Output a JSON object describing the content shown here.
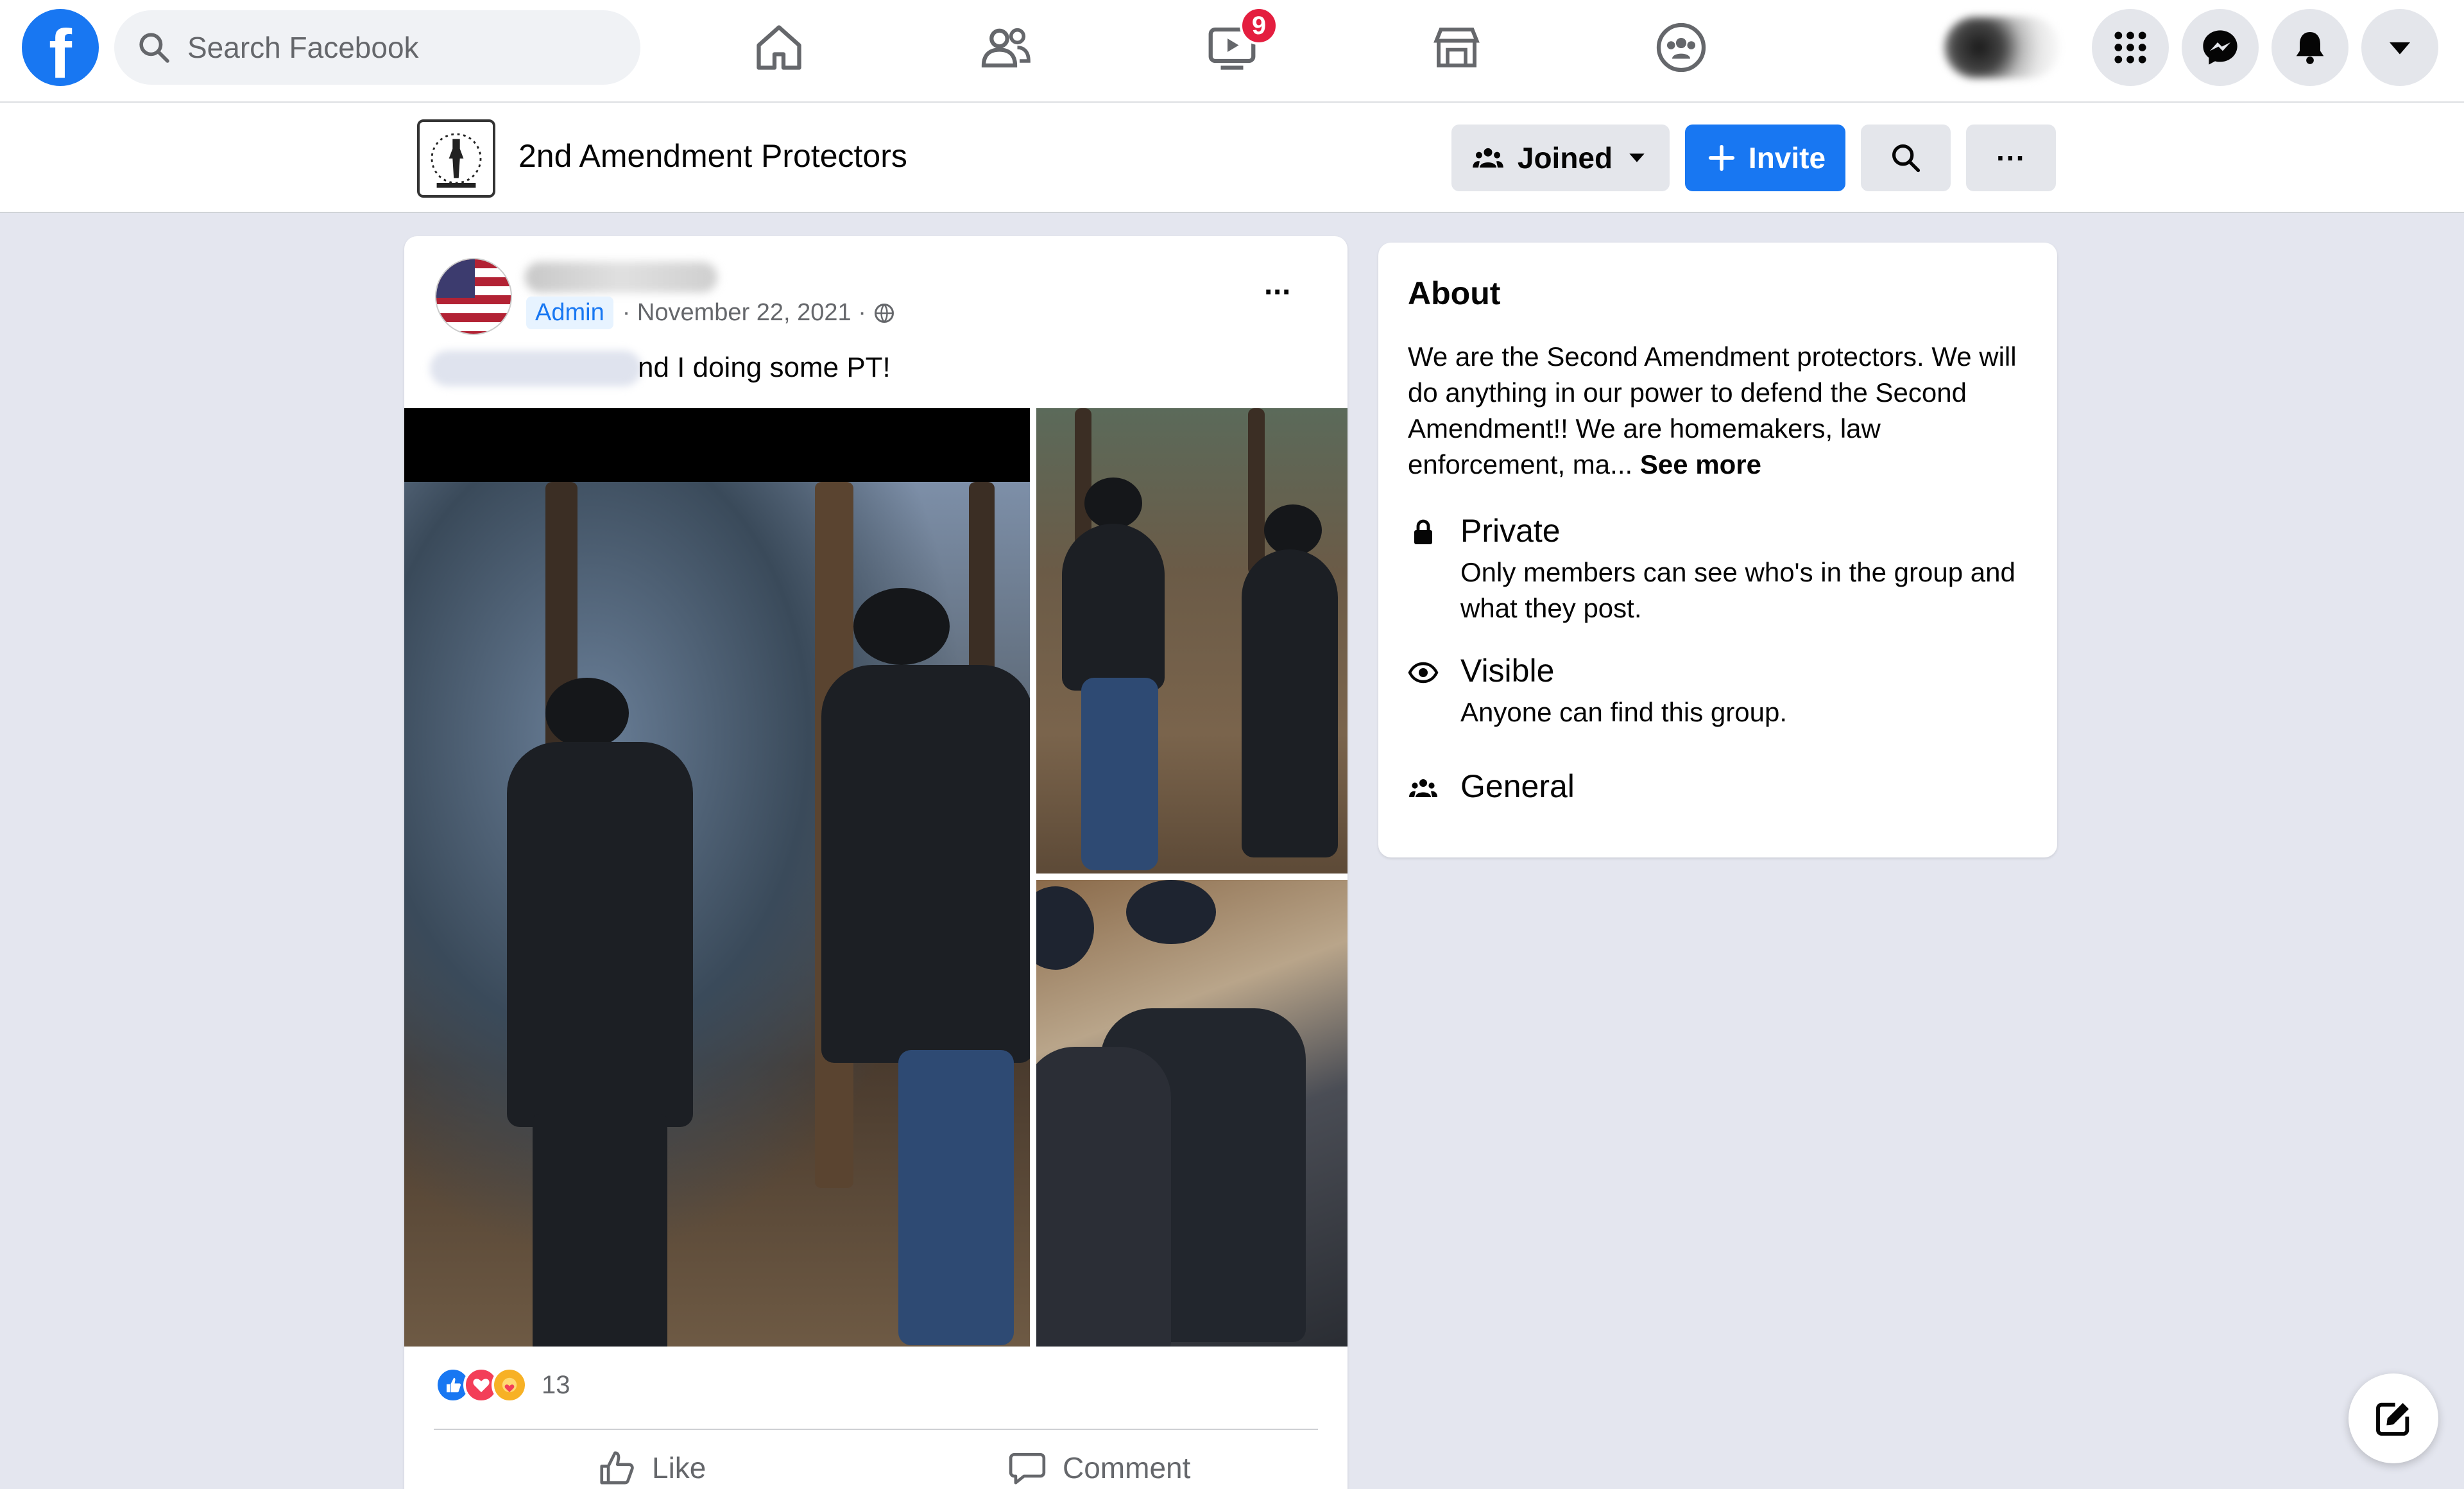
{
  "topnav": {
    "logo_letter": "f",
    "search_placeholder": "Search Facebook",
    "watch_badge": "9"
  },
  "group": {
    "name": "2nd Amendment Protectors",
    "joined_label": "Joined",
    "invite_label": "Invite",
    "more_label": "···"
  },
  "post": {
    "author_role": "Admin",
    "date": "· November 22, 2021 ·",
    "text": "nd I doing some PT!",
    "menu_label": "···",
    "reaction_count": "13",
    "like_label": "Like",
    "comment_label": "Comment"
  },
  "about": {
    "title": "About",
    "description": "We are the Second Amendment protectors. We will do anything in our power to defend the Second Amendment!! We are homemakers, law enforcement, ma...",
    "see_more": "See more",
    "private_title": "Private",
    "private_sub": "Only members can see who's in the group and what they post.",
    "visible_title": "Visible",
    "visible_sub": "Anyone can find this group.",
    "general_title": "General"
  },
  "colors": {
    "brand": "#1877f2",
    "badge": "#e41e3f",
    "background": "#e4e6ef"
  },
  "icons": [
    "home-icon",
    "friends-icon",
    "watch-icon",
    "marketplace-icon",
    "groups-icon",
    "menu-grid-icon",
    "messenger-icon",
    "notifications-icon",
    "account-caret-icon",
    "search-icon",
    "lock-icon",
    "eye-icon",
    "people-icon",
    "globe-icon",
    "like-icon",
    "comment-icon",
    "compose-icon"
  ]
}
